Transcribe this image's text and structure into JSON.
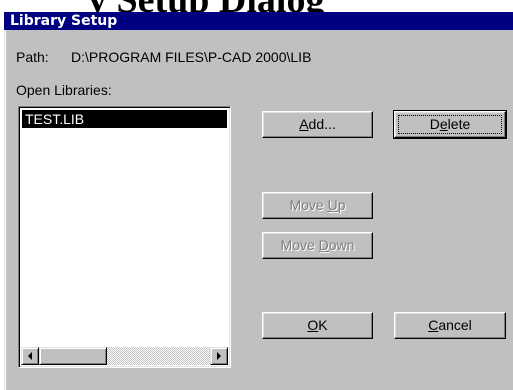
{
  "background": {
    "heading_partial": "y Setup Dialog"
  },
  "dialog": {
    "title": "Library Setup",
    "path_label": "Path:",
    "path_value": "D:\\PROGRAM FILES\\P-CAD 2000\\LIB",
    "open_libraries_label": "Open Libraries:",
    "libraries": [
      "TEST.LIB"
    ],
    "selected_index": 0
  },
  "buttons": {
    "add": {
      "pre": "",
      "mnemonic": "A",
      "post": "dd..."
    },
    "delete": {
      "pre": "D",
      "mnemonic": "e",
      "post": "lete"
    },
    "move_up": {
      "pre": "Move ",
      "mnemonic": "U",
      "post": "p"
    },
    "move_down": {
      "pre": "Move ",
      "mnemonic": "D",
      "post": "own"
    },
    "ok": {
      "pre": "",
      "mnemonic": "O",
      "post": "K"
    },
    "cancel": {
      "pre": "",
      "mnemonic": "C",
      "post": "ancel"
    }
  },
  "colors": {
    "titlebar": "#000080",
    "dialog_face": "#c0c0c0",
    "selection": "#000000"
  },
  "icons": {
    "scroll_left": "left-arrow-icon",
    "scroll_right": "right-arrow-icon"
  }
}
